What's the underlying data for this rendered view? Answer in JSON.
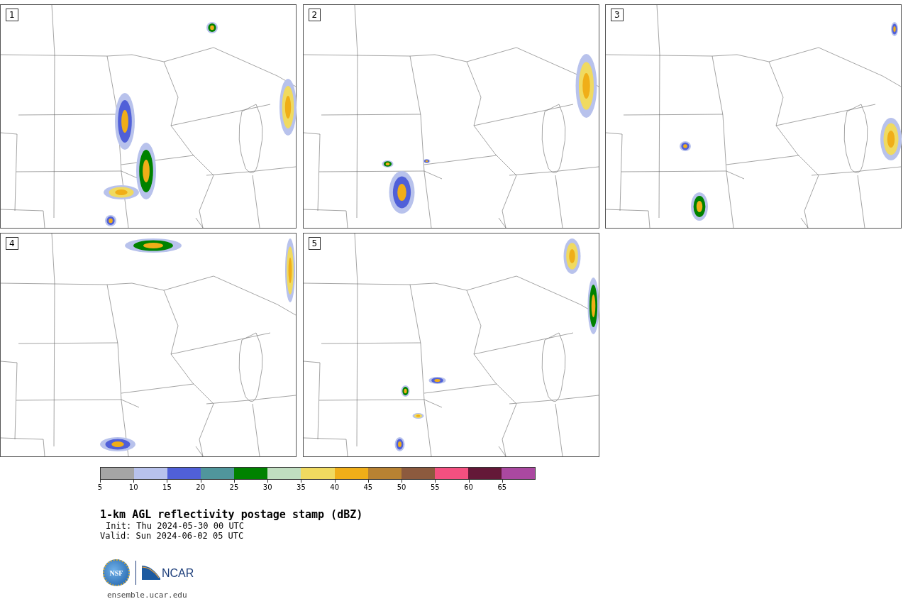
{
  "panels": [
    {
      "label": "1"
    },
    {
      "label": "2"
    },
    {
      "label": "3"
    },
    {
      "label": "4"
    },
    {
      "label": "5"
    }
  ],
  "colorbar": {
    "bins": [
      {
        "color": "#a5a5a5"
      },
      {
        "color": "#b8c2ec"
      },
      {
        "color": "#5060d8"
      },
      {
        "color": "#50969c"
      },
      {
        "color": "#008200"
      },
      {
        "color": "#c0dec0"
      },
      {
        "color": "#f0da60"
      },
      {
        "color": "#f0ae18"
      },
      {
        "color": "#b88232"
      },
      {
        "color": "#8c5a3e"
      },
      {
        "color": "#f45080"
      },
      {
        "color": "#641838"
      },
      {
        "color": "#aa48a0"
      }
    ],
    "ticks": [
      "5",
      "10",
      "15",
      "20",
      "25",
      "30",
      "35",
      "40",
      "45",
      "50",
      "55",
      "60",
      "65"
    ]
  },
  "title": "1-km AGL reflectivity postage stamp (dBZ)",
  "init": "Init: Thu 2024-05-30 00 UTC",
  "valid": "Valid: Sun 2024-06-02 05 UTC",
  "logo": {
    "nsf": "NSF",
    "ncar": "NCAR"
  },
  "footer": {
    "url": "ensemble.ucar.edu"
  }
}
